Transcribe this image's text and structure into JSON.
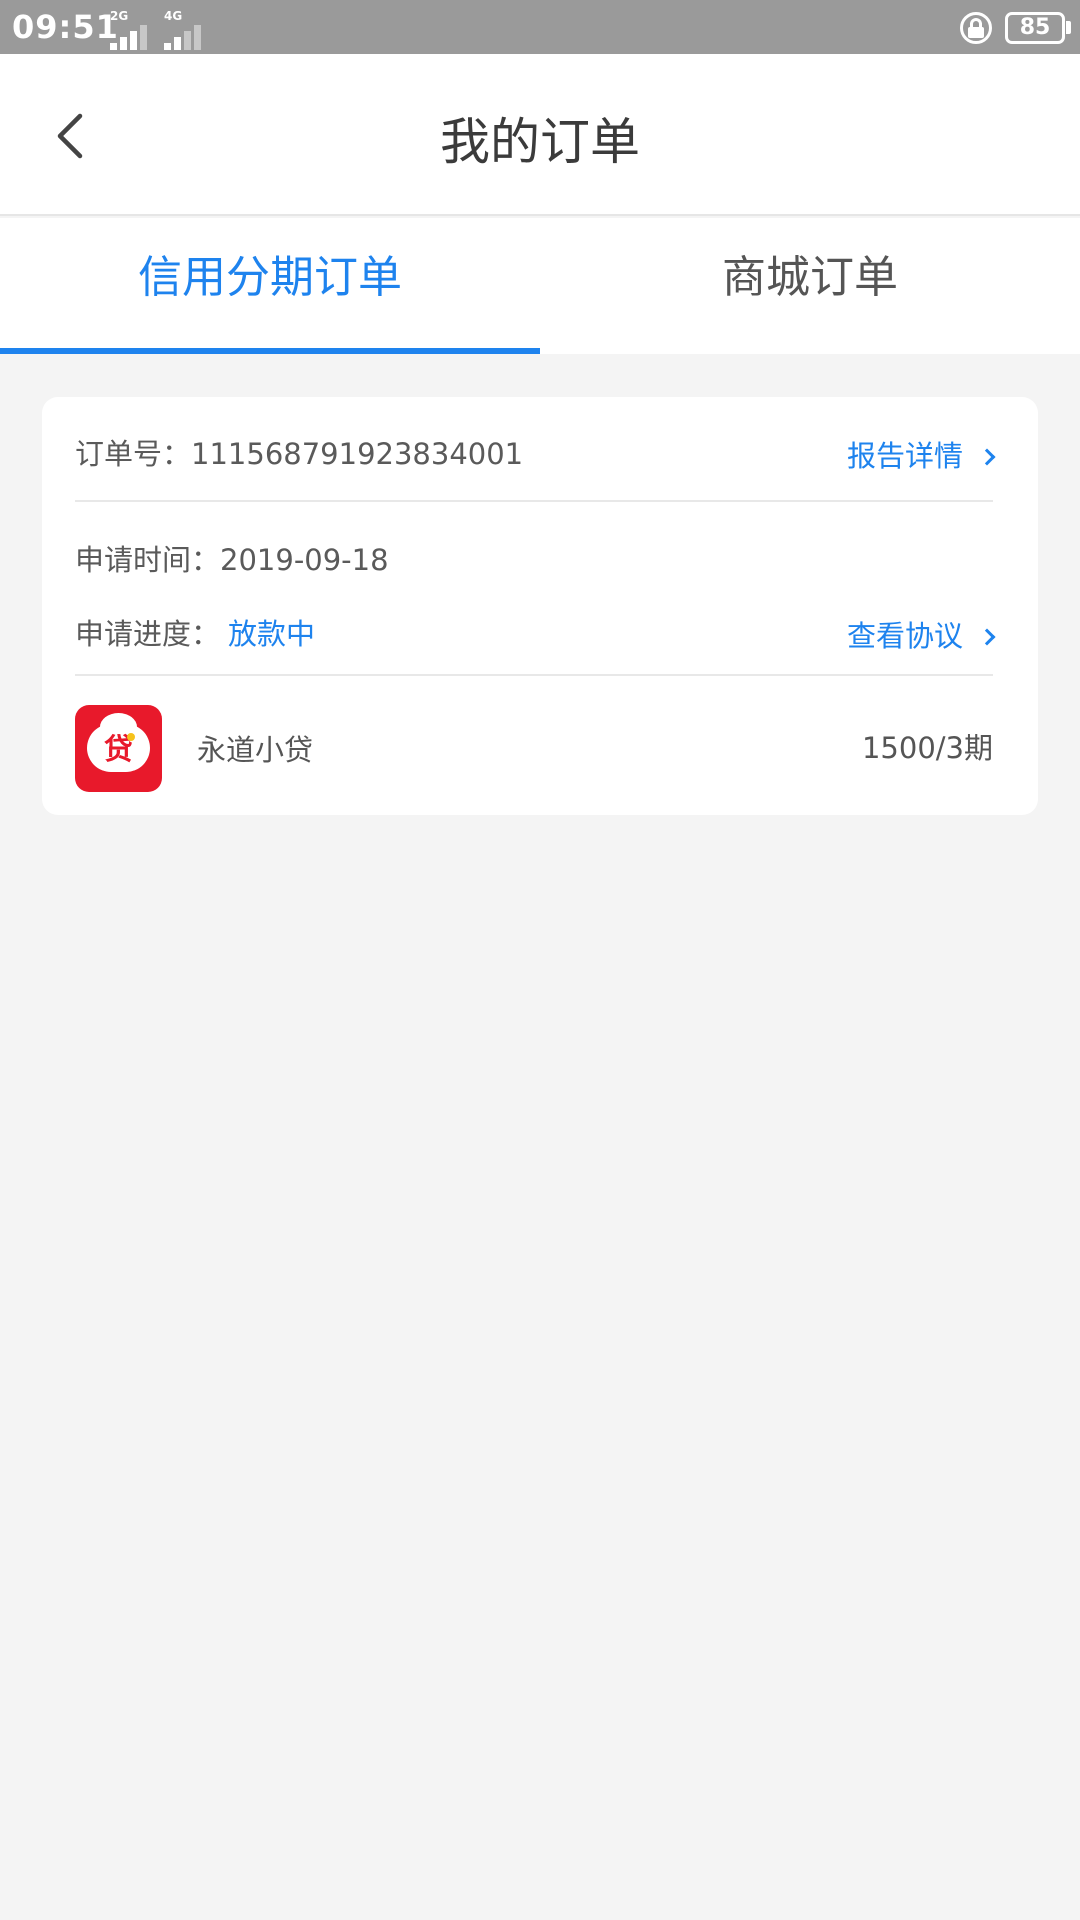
{
  "status_bar": {
    "time": "09:51",
    "sim1_network": "2G",
    "sim2_network": "4G",
    "battery_level": "85",
    "icons": [
      "signal-icon",
      "lock-rotation-icon",
      "battery-icon"
    ]
  },
  "header": {
    "title": "我的订单",
    "back_icon": "chevron-left-icon"
  },
  "tabs": [
    {
      "label": "信用分期订单",
      "active": true
    },
    {
      "label": "商城订单",
      "active": false
    }
  ],
  "order": {
    "order_number_label": "订单号：",
    "order_number": "111568791923834001",
    "report_link": "报告详情",
    "apply_time_label": "申请时间：",
    "apply_time": "2019-09-18",
    "progress_label": "申请进度：",
    "progress_status": "放款中",
    "agreement_link": "查看协议",
    "lender": {
      "logo_text": "贷",
      "name": "永道小贷",
      "terms": "1500/3期"
    }
  },
  "colors": {
    "accent": "#1e83ee",
    "status_bar": "#9a9a9a",
    "background": "#f4f4f4",
    "logo_red": "#e8192b"
  }
}
